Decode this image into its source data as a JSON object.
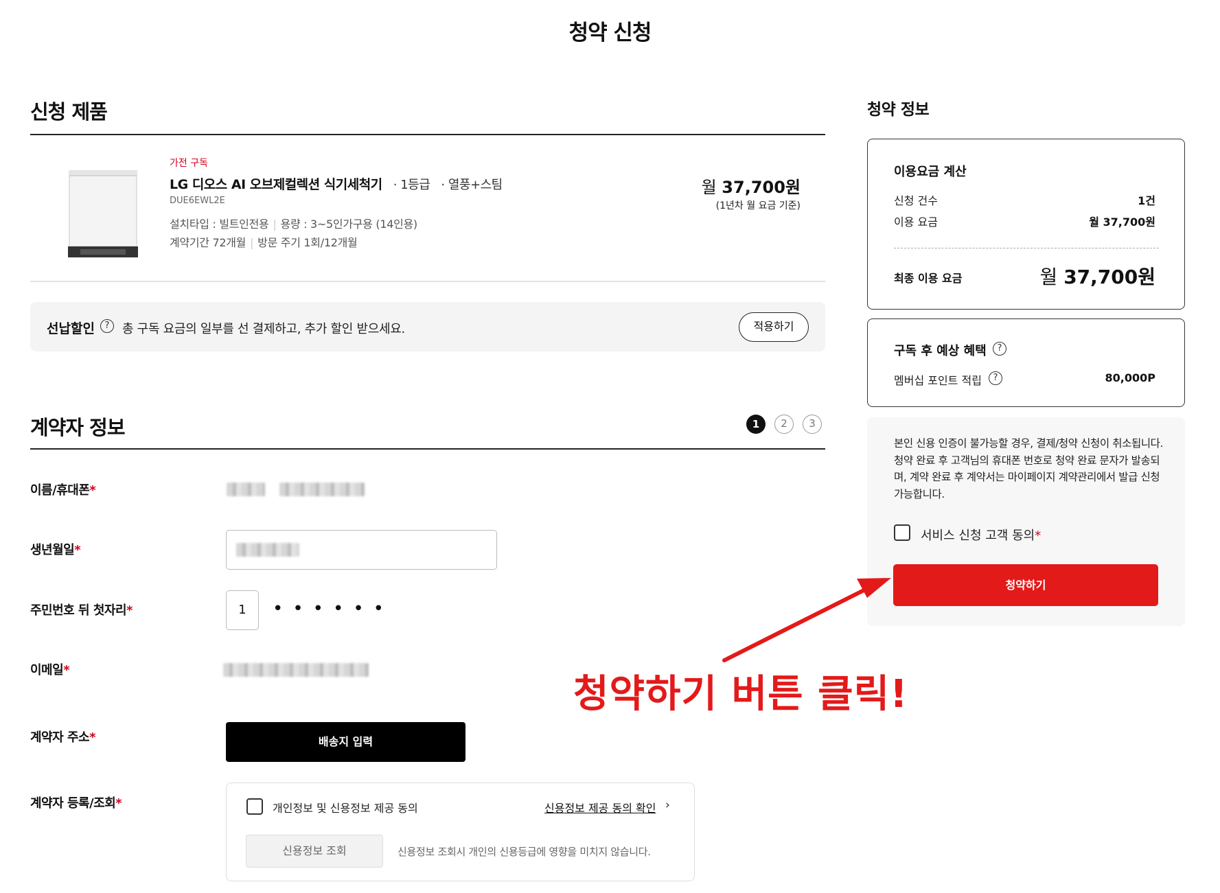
{
  "page": {
    "title": "청약 신청"
  },
  "product_section": {
    "title": "신청 제품",
    "tag": "가전 구독",
    "name": "LG 디오스 AI 오브제컬렉션 식기세척기",
    "grade": "· 1등급",
    "option": "· 열풍+스팀",
    "model": "DUE6EWL2E",
    "spec_line1": [
      "설치타입 : 빌트인전용",
      "용량 : 3~5인가구용 (14인용)"
    ],
    "spec_line2": [
      "계약기간 72개월",
      "방문 주기 1회/12개월"
    ],
    "price_prefix": "월",
    "price": "37,700원",
    "price_note": "(1년차 월 요금 기준)"
  },
  "prepay": {
    "label": "선납할인",
    "help_icon": "?",
    "text": "총 구독 요금의 일부를 선 결제하고, 추가 할인 받으세요.",
    "apply_label": "적용하기"
  },
  "contract_section": {
    "title": "계약자 정보",
    "steps": [
      "1",
      "2",
      "3"
    ],
    "required_mark": "*",
    "labels": {
      "name_phone": "이름/휴대폰",
      "birth": "생년월일",
      "rrn": "주민번호 뒤 첫자리",
      "email": "이메일",
      "address": "계약자 주소",
      "register": "계약자 등록/조회"
    },
    "rrn_first_digit": "1",
    "rrn_masked": "••••••",
    "address_button": "배송지 입력",
    "consent_text": "개인정보 및 신용정보 제공 동의",
    "consent_link": "신용정보 제공 동의 확인",
    "consent_chevron": "›",
    "credit_button": "신용정보 조회",
    "credit_note": "신용정보 조회시 개인의 신용등급에 영향을 미치지 않습니다."
  },
  "sidebar": {
    "title": "청약 정보",
    "fee_card": {
      "title": "이용요금 계산",
      "rows": [
        {
          "label": "신청 건수",
          "value": "1건"
        },
        {
          "label": "이용 요금",
          "value": "월 37,700원"
        }
      ],
      "final_label": "최종 이용 요금",
      "final_prefix": "월",
      "final_value": "37,700원"
    },
    "benefit_card": {
      "title": "구독 후 예상 혜택",
      "row_label": "멤버십 포인트 적립",
      "row_value": "80,000P"
    },
    "notice": "본인 신용 인증이 불가능할 경우, 결제/청약 신청이 취소됩니다. 청약 완료 후 고객님의 휴대폰 번호로 청약 완료 문자가 발송되며, 계약 완료 후 계약서는 마이페이지 계약관리에서 발급 신청 가능합니다.",
    "agree_label": "서비스 신청 고객 동의",
    "submit_label": "청약하기"
  },
  "annotation": {
    "text": "청약하기 버튼 클릭!",
    "color": "#e31a1a"
  },
  "colors": {
    "accent": "#e31a1a",
    "tag": "#d0021b"
  }
}
